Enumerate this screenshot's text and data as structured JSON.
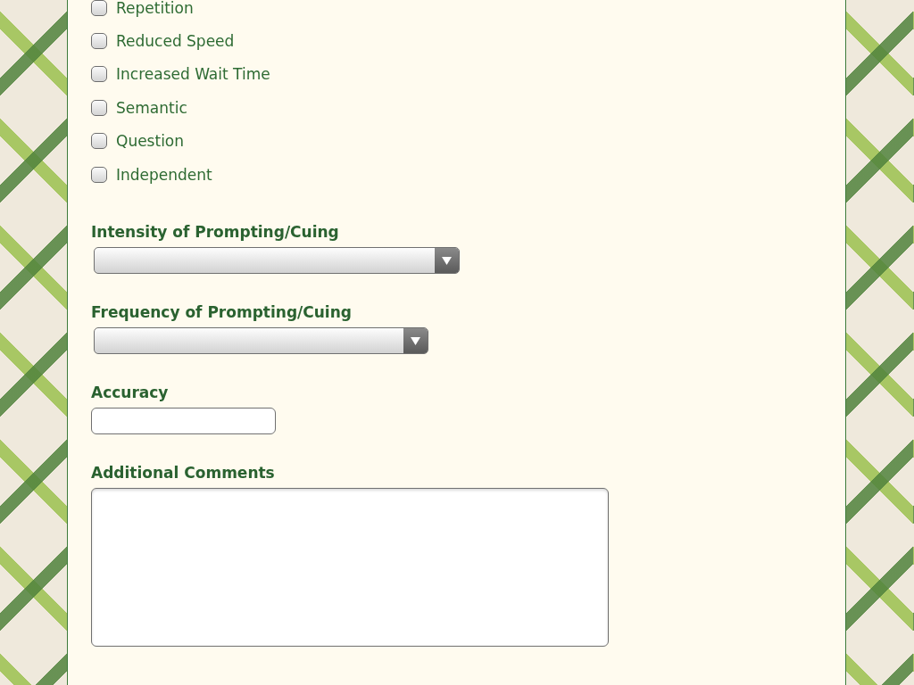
{
  "options": [
    {
      "label": "Repetition",
      "checked": false
    },
    {
      "label": "Reduced Speed",
      "checked": false
    },
    {
      "label": "Increased Wait Time",
      "checked": false
    },
    {
      "label": "Semantic",
      "checked": false
    },
    {
      "label": "Question",
      "checked": false
    },
    {
      "label": "Independent",
      "checked": false
    }
  ],
  "fields": [
    {
      "kind": "select",
      "label": "Intensity of Prompting/Cuing"
    },
    {
      "kind": "select",
      "label": "Frequency of Prompting/Cuing"
    },
    {
      "kind": "input",
      "label": "Accuracy"
    },
    {
      "kind": "textarea",
      "label": "Additional Comments"
    }
  ]
}
